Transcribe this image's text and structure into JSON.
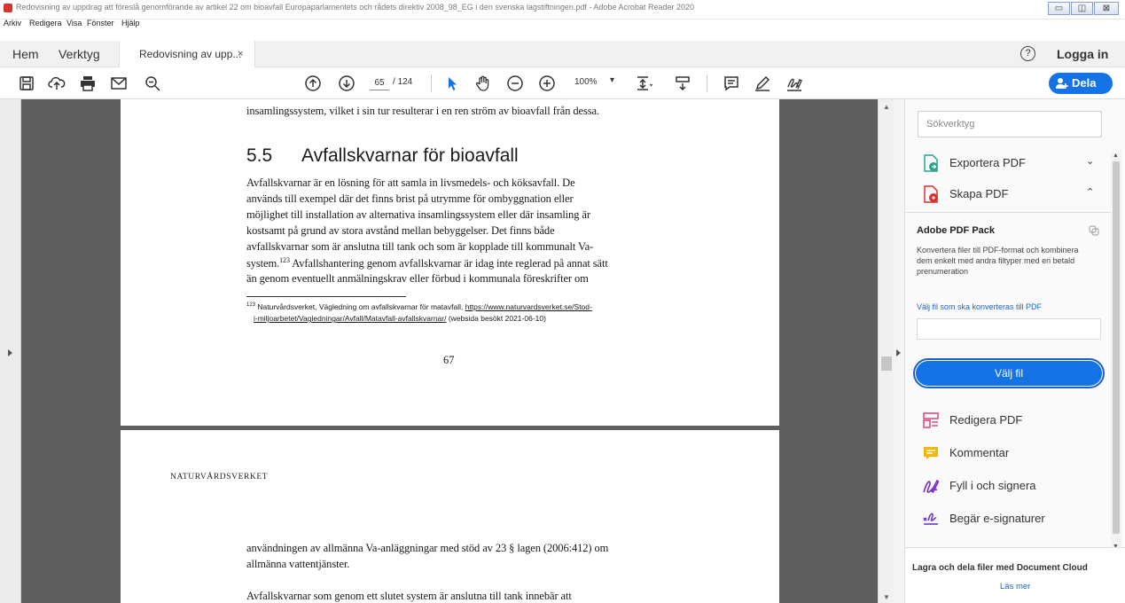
{
  "window": {
    "title": "Redovisning av uppdrag att föreslå genomförande av artikel 22 om bioavfall Europaparlamentets och rådets direktiv 2008_98_EG i den svenska lagstiftningen.pdf - Adobe Acrobat Reader 2020",
    "controls": {
      "minimize": "▭",
      "maximize": "◫",
      "close": "⊠"
    }
  },
  "menu": [
    "Arkiv",
    "Redigera",
    "Visa",
    "Fönster",
    "Hjälp"
  ],
  "tabs": {
    "home": "Hem",
    "tools": "Verktyg",
    "document": "Redovisning av upp...",
    "document_close": "×"
  },
  "header": {
    "help": "?",
    "login": "Logga in"
  },
  "toolbar": {
    "page_current": "65",
    "page_total": "/ 124",
    "zoom": "100%",
    "zoom_caret": "▾",
    "share_label": "Dela"
  },
  "page1": {
    "line0": "insamlingssystem, vilket i sin tur resulterar i en ren ström av bioavfall från dessa.",
    "heading_number": "5.5",
    "heading_text": "Avfallskvarnar för bioavfall",
    "body": [
      "Avfallskvarnar är en lösning för att samla in livsmedels- och köksavfall. De",
      "används till exempel där det finns brist på utrymme för ombyggnation eller",
      "möjlighet till installation av alternativa insamlingssystem eller där insamling är",
      "kostsamt på grund av stora avstånd mellan bebyggelser. Det finns både",
      "avfallskvarnar som är anslutna till tank och som är kopplade till kommunalt Va-"
    ],
    "line_ref_a": "system.",
    "line_ref_sup": "123",
    "line_ref_b": " Avfallshantering genom avfallskvarnar är idag inte reglerad på annat sätt",
    "line_last": "än genom eventuellt anmälningskrav eller förbud i kommunala föreskrifter om",
    "footnote_num": "123",
    "footnote_a": " Naturvårdsverket, Vägledning om avfallskvarnar för matavfall, ",
    "footnote_link_1": "https://www.naturvardsverket.se/Stod-",
    "footnote_link_2": "i-miljoarbetet/Vagledningar/Avfall/Matavfall-avfallskvarnar/",
    "footnote_b": " (websida besökt 2021-06-10)",
    "page_number": "67"
  },
  "page2": {
    "running_head": "NATURVÅRDSVERKET",
    "body": [
      "användningen av allmänna Va-anläggningar med stöd av 23 § lagen (2006:412) om",
      "allmänna vattentjänster."
    ],
    "para2": "Avfallskvarnar som genom ett slutet system är anslutna till tank innebär att"
  },
  "right_pane": {
    "search_placeholder": "Sökverktyg",
    "export_pdf": "Exportera PDF",
    "create_pdf": "Skapa PDF",
    "chev_down": "⌄",
    "chev_up": "⌃",
    "pack_title": "Adobe PDF Pack",
    "pack_desc": "Konvertera filer till PDF-format och kombinera dem enkelt med andra filtyper med en betald prenumeration",
    "select_label": "Välj fil som ska konverteras till PDF",
    "choose_file": "Välj fil",
    "tools": [
      "Redigera PDF",
      "Kommentar",
      "Fyll i och signera",
      "Begär e-signaturer"
    ],
    "cloud_title": "Lagra och dela filer med Document Cloud",
    "cloud_link": "Läs mer"
  },
  "colors": {
    "accent": "#1473e6",
    "doc_background": "#5f5f5f",
    "export_icon": "#2aa58a",
    "create_icon": "#d9312b",
    "edit_icon": "#e04f7f",
    "comment_icon": "#f2b705",
    "sign_icon": "#7b2bc9",
    "esign_icon": "#6b3bc7"
  },
  "icons": [
    "save-icon",
    "upload-icon",
    "print-icon",
    "email-icon",
    "zoom-search-icon",
    "prev-page-icon",
    "next-page-icon",
    "select-arrow-icon",
    "hand-icon",
    "zoom-out-icon",
    "zoom-in-icon",
    "fit-page-icon",
    "scroll-mode-icon",
    "comment-icon",
    "pen-icon",
    "sign-icon"
  ]
}
